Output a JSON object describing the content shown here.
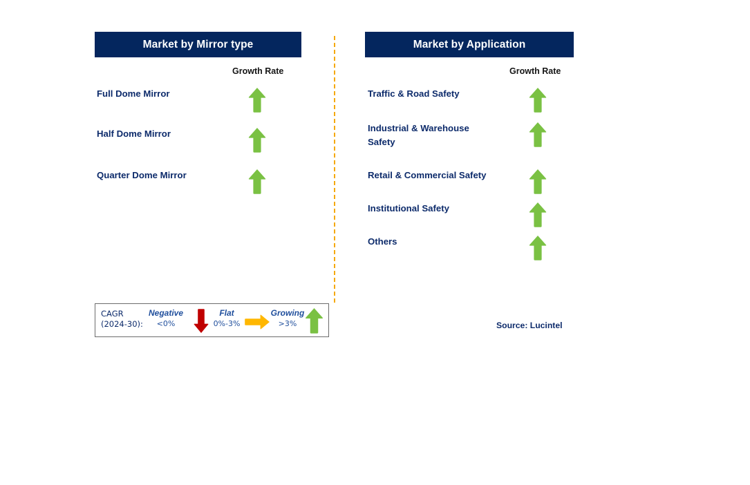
{
  "divider": {
    "color": "#f5a800",
    "style": "dashed-vertical"
  },
  "colors": {
    "header_bg": "#04265e",
    "header_text": "#ffffff",
    "label_text": "#0d2b6b",
    "arrow_growing": "#7ac143",
    "arrow_negative": "#c00000",
    "arrow_flat": "#ffb700",
    "divider": "#f5a800"
  },
  "panels": [
    {
      "id": "mirror",
      "title": "Market by Mirror type",
      "column_header": "Growth Rate",
      "rows": [
        {
          "label": "Full Dome Mirror",
          "growth": "growing",
          "icon": "arrow-up-icon"
        },
        {
          "label": "Half Dome Mirror",
          "growth": "growing",
          "icon": "arrow-up-icon"
        },
        {
          "label": "Quarter Dome Mirror",
          "growth": "growing",
          "icon": "arrow-up-icon"
        }
      ]
    },
    {
      "id": "application",
      "title": "Market by Application",
      "column_header": "Growth Rate",
      "rows": [
        {
          "label": "Traffic & Road Safety",
          "growth": "growing",
          "icon": "arrow-up-icon"
        },
        {
          "label": "Industrial & Warehouse\nSafety",
          "growth": "growing",
          "icon": "arrow-up-icon"
        },
        {
          "label": "Retail & Commercial Safety",
          "growth": "growing",
          "icon": "arrow-up-icon"
        },
        {
          "label": "Institutional Safety",
          "growth": "growing",
          "icon": "arrow-up-icon"
        },
        {
          "label": "Others",
          "growth": "growing",
          "icon": "arrow-up-icon"
        }
      ]
    }
  ],
  "legend": {
    "cagr_line1": "CAGR",
    "cagr_line2": "(2024-30):",
    "items": [
      {
        "title": "Negative",
        "value": "<0%",
        "icon": "arrow-down-icon",
        "color": "#c00000"
      },
      {
        "title": "Flat",
        "value": "0%-3%",
        "icon": "arrow-right-icon",
        "color": "#ffb700"
      },
      {
        "title": "Growing",
        "value": ">3%",
        "icon": "arrow-up-icon",
        "color": "#7ac143"
      }
    ]
  },
  "source": "Source: Lucintel"
}
